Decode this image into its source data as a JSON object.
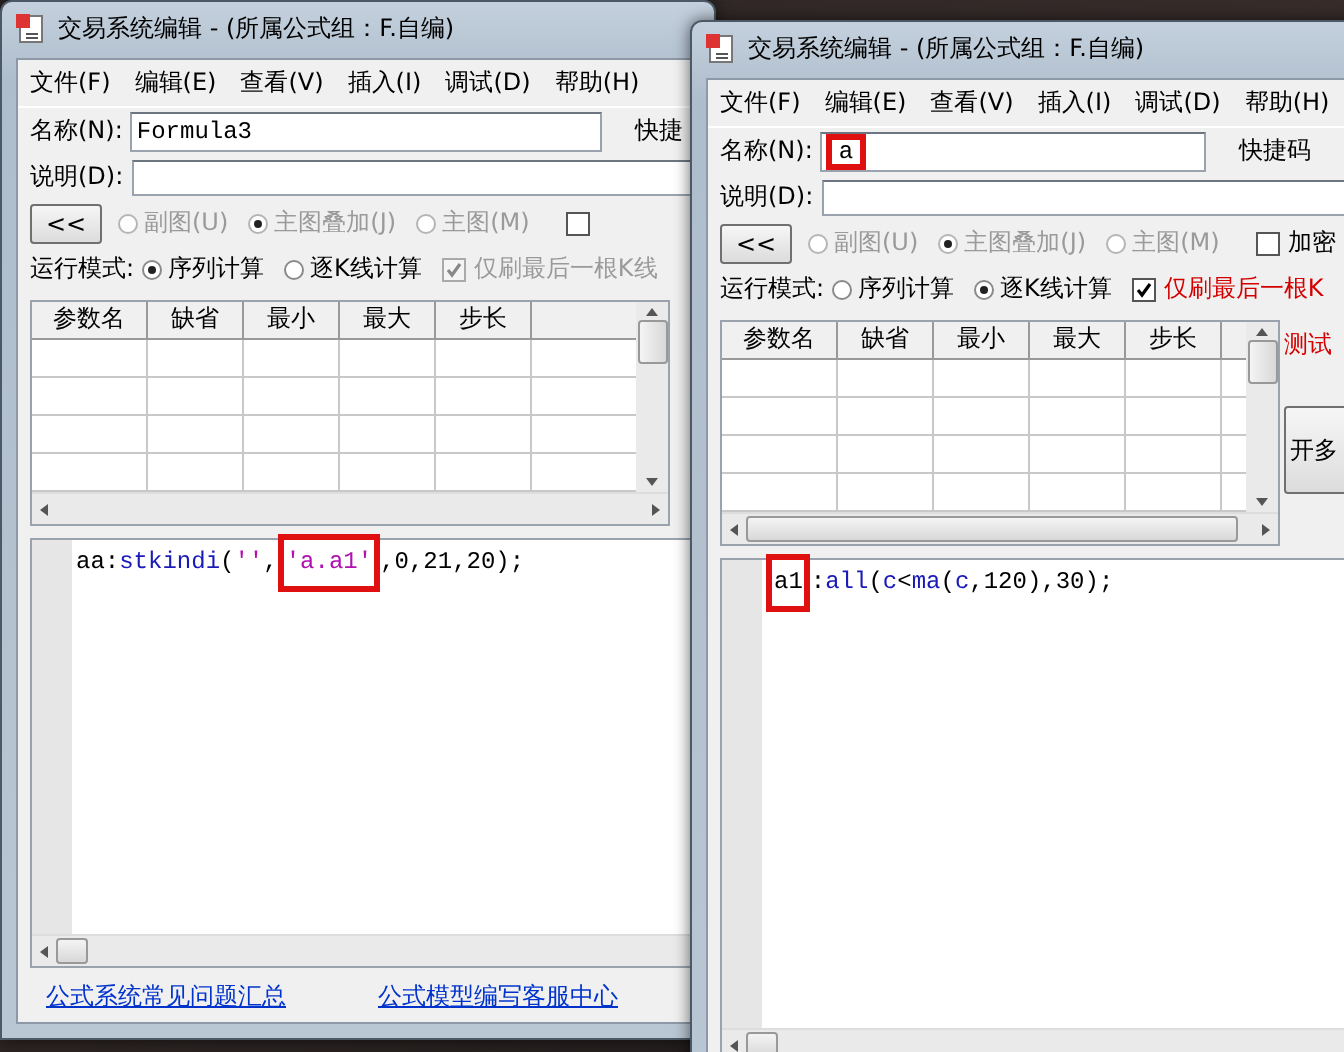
{
  "windows": [
    {
      "title": "交易系统编辑 - (所属公式组：F.自编)",
      "menu": [
        "文件(F)",
        "编辑(E)",
        "查看(V)",
        "插入(I)",
        "调试(D)",
        "帮助(H)"
      ],
      "name": {
        "label": "名称(N):",
        "value": "Formula3",
        "highlighted": false
      },
      "shortcut_label": "快捷",
      "description": {
        "label": "说明(D):"
      },
      "collapse_button": "<<",
      "chart_types": [
        {
          "label": "副图(U)",
          "selected": false,
          "disabled": true
        },
        {
          "label": "主图叠加(J)",
          "selected": true,
          "disabled": true
        },
        {
          "label": "主图(M)",
          "selected": false,
          "disabled": true
        }
      ],
      "encrypt": {
        "checked": false
      },
      "run_mode_label": "运行模式:",
      "run_modes": [
        {
          "label": "序列计算",
          "selected": true
        },
        {
          "label": "逐K线计算",
          "selected": false
        }
      ],
      "refresh_last": {
        "label": "仅刷最后一根K线",
        "checked": true,
        "disabled": true
      },
      "columns": [
        "参数名",
        "缺省",
        "最小",
        "最大",
        "步长"
      ],
      "code": [
        {
          "text": "aa:",
          "kind": "plain",
          "highlighted": false
        },
        {
          "text": "stkindi",
          "kind": "function",
          "highlighted": false
        },
        {
          "text": "(",
          "kind": "plain",
          "highlighted": false
        },
        {
          "text": "''",
          "kind": "string",
          "highlighted": false
        },
        {
          "text": ",",
          "kind": "plain",
          "highlighted": false
        },
        {
          "text": "'a.a1'",
          "kind": "string",
          "highlighted": true
        },
        {
          "text": ",0,21,20);",
          "kind": "plain",
          "highlighted": false
        }
      ],
      "links": [
        "公式系统常见问题汇总",
        "公式模型编写客服中心"
      ]
    },
    {
      "title": "交易系统编辑 - (所属公式组：F.自编)",
      "menu": [
        "文件(F)",
        "编辑(E)",
        "查看(V)",
        "插入(I)",
        "调试(D)",
        "帮助(H)"
      ],
      "name": {
        "label": "名称(N):",
        "value": "a",
        "highlighted": true
      },
      "shortcut_label": "快捷码",
      "description": {
        "label": "说明(D):"
      },
      "collapse_button": "<<",
      "chart_types": [
        {
          "label": "副图(U)",
          "selected": false,
          "disabled": true
        },
        {
          "label": "主图叠加(J)",
          "selected": true,
          "disabled": true
        },
        {
          "label": "主图(M)",
          "selected": false,
          "disabled": true
        }
      ],
      "encrypt": {
        "label": "加密",
        "checked": false
      },
      "run_mode_label": "运行模式:",
      "run_modes": [
        {
          "label": "序列计算",
          "selected": false
        },
        {
          "label": "逐K线计算",
          "selected": true
        }
      ],
      "refresh_last": {
        "label": "仅刷最后一根K",
        "checked": true,
        "disabled": false
      },
      "columns": [
        "参数名",
        "缺省",
        "最小",
        "最大",
        "步长"
      ],
      "side_panel": {
        "test_label": "测试",
        "button": "开多"
      },
      "code": [
        {
          "text": "a1",
          "kind": "plain",
          "highlighted": true
        },
        {
          "text": ":",
          "kind": "plain",
          "highlighted": false
        },
        {
          "text": "all",
          "kind": "function",
          "highlighted": false
        },
        {
          "text": "(",
          "kind": "plain",
          "highlighted": false
        },
        {
          "text": "c",
          "kind": "function",
          "highlighted": false
        },
        {
          "text": "<",
          "kind": "plain",
          "highlighted": false
        },
        {
          "text": "ma",
          "kind": "function",
          "highlighted": false
        },
        {
          "text": "(",
          "kind": "plain",
          "highlighted": false
        },
        {
          "text": "c",
          "kind": "function",
          "highlighted": false
        },
        {
          "text": ",120),30);",
          "kind": "plain",
          "highlighted": false
        }
      ]
    }
  ]
}
